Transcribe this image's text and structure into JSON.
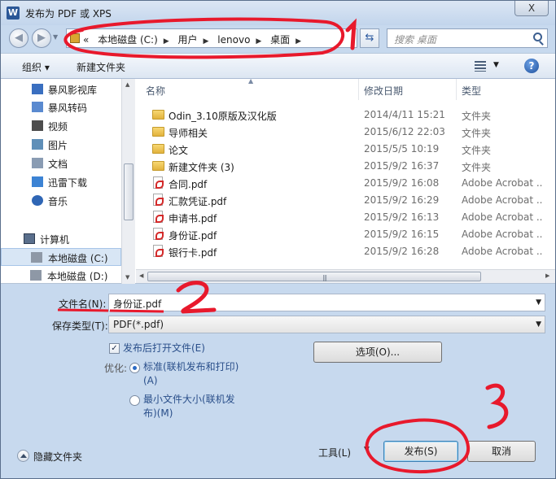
{
  "window": {
    "title": "发布为 PDF 或 XPS",
    "app_icon": "W",
    "close_label": "X"
  },
  "navigation": {
    "back_icon": "back-arrow-icon",
    "forward_icon": "forward-arrow-icon",
    "address_prefix": "«",
    "breadcrumbs": [
      "本地磁盘 (C:)",
      "用户",
      "lenovo",
      "桌面"
    ],
    "search_placeholder": "搜索 桌面"
  },
  "toolbar": {
    "organize_label": "组织 ▾",
    "new_folder_label": "新建文件夹",
    "help_label": "?"
  },
  "sidebar": {
    "items": [
      {
        "label": "暴风影视库",
        "icon": "video-library-icon",
        "color": "#3a6fc0"
      },
      {
        "label": "暴风转码",
        "icon": "convert-icon",
        "color": "#5a8ad0"
      },
      {
        "label": "视频",
        "icon": "film-icon",
        "color": "#4d4d4d"
      },
      {
        "label": "图片",
        "icon": "picture-icon",
        "color": "#5f8fb8"
      },
      {
        "label": "文档",
        "icon": "document-icon",
        "color": "#8a9cb3"
      },
      {
        "label": "迅雷下载",
        "icon": "download-icon",
        "color": "#3c83d4"
      },
      {
        "label": "音乐",
        "icon": "music-icon",
        "color": "#2f66b5"
      }
    ],
    "computer_label": "计算机",
    "drives": [
      {
        "label": "本地磁盘 (C:)",
        "selected": true
      },
      {
        "label": "本地磁盘 (D:)",
        "selected": false
      }
    ]
  },
  "files": {
    "columns": [
      "名称",
      "修改日期",
      "类型"
    ],
    "rows": [
      {
        "name": "Odin_3.10原版及汉化版",
        "date": "2014/4/11 15:21",
        "type": "文件夹",
        "kind": "folder"
      },
      {
        "name": "导师相关",
        "date": "2015/6/12 22:03",
        "type": "文件夹",
        "kind": "folder"
      },
      {
        "name": "论文",
        "date": "2015/5/5 10:19",
        "type": "文件夹",
        "kind": "folder"
      },
      {
        "name": "新建文件夹 (3)",
        "date": "2015/9/2 16:37",
        "type": "文件夹",
        "kind": "folder"
      },
      {
        "name": "合同.pdf",
        "date": "2015/9/2 16:08",
        "type": "Adobe Acrobat ...",
        "kind": "pdf"
      },
      {
        "name": "汇款凭证.pdf",
        "date": "2015/9/2 16:29",
        "type": "Adobe Acrobat ...",
        "kind": "pdf"
      },
      {
        "name": "申请书.pdf",
        "date": "2015/9/2 16:13",
        "type": "Adobe Acrobat ...",
        "kind": "pdf"
      },
      {
        "name": "身份证.pdf",
        "date": "2015/9/2 16:15",
        "type": "Adobe Acrobat ...",
        "kind": "pdf"
      },
      {
        "name": "银行卡.pdf",
        "date": "2015/9/2 16:28",
        "type": "Adobe Acrobat ...",
        "kind": "pdf"
      }
    ]
  },
  "form": {
    "filename_label": "文件名(N):",
    "filename_value": "身份证.pdf",
    "filetype_label": "保存类型(T):",
    "filetype_value": "PDF(*.pdf)",
    "open_after_label": "发布后打开文件(E)",
    "open_after_checked": true,
    "optimize_label": "优化:",
    "opt_standard_line1": "标准(联机发布和打印)",
    "opt_standard_line2": "(A)",
    "opt_min_line1": "最小文件大小(联机发",
    "opt_min_line2": "布)(M)",
    "options_button": "选项(O)...",
    "hide_folders_label": "隐藏文件夹",
    "tools_label": "工具(L)",
    "publish_button": "发布(S)",
    "cancel_button": "取消"
  },
  "annotations": {
    "n1": "1",
    "n2": "2",
    "n3": "3",
    "ink_color": "#e8192c"
  }
}
